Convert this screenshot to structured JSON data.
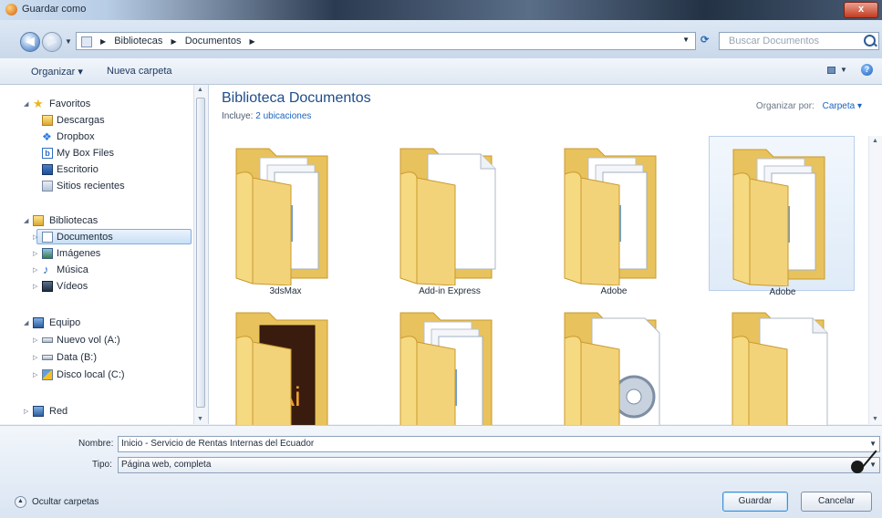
{
  "window": {
    "title": "Guardar como",
    "close_label": "x"
  },
  "address": {
    "crumbs": [
      "Bibliotecas",
      "Documentos"
    ],
    "search_placeholder": "Buscar Documentos"
  },
  "toolbar": {
    "organize": "Organizar ▾",
    "new_folder": "Nueva carpeta"
  },
  "nav": {
    "favorites": "Favoritos",
    "fav_items": [
      "Descargas",
      "Dropbox",
      "My Box Files",
      "Escritorio",
      "Sitios recientes"
    ],
    "libraries": "Bibliotecas",
    "lib_items": [
      "Documentos",
      "Imágenes",
      "Música",
      "Vídeos"
    ],
    "computer": "Equipo",
    "computer_items": [
      "Nuevo vol (A:)",
      "Data (B:)",
      "Disco local (C:)"
    ],
    "network": "Red"
  },
  "content": {
    "title": "Biblioteca Documentos",
    "includes_prefix": "Incluye:",
    "includes_link": "2 ubicaciones",
    "arrange_label": "Organizar por:",
    "arrange_value": "Carpeta ▾",
    "folders": [
      {
        "label": "3dsMax",
        "variant": "docs",
        "selected": false
      },
      {
        "label": "Add-in Express",
        "variant": "paper",
        "selected": false
      },
      {
        "label": "Adobe",
        "variant": "docs",
        "selected": false
      },
      {
        "label": "Adobe",
        "variant": "docs",
        "selected": true
      },
      {
        "label": "",
        "variant": "ai",
        "selected": false
      },
      {
        "label": "",
        "variant": "docs",
        "selected": false
      },
      {
        "label": "",
        "variant": "gear",
        "selected": false
      },
      {
        "label": "",
        "variant": "paper",
        "selected": false
      }
    ]
  },
  "form": {
    "name_label": "Nombre:",
    "name_value": "Inicio - Servicio de Rentas Internas del Ecuador",
    "type_label": "Tipo:",
    "type_value": "Página web, completa"
  },
  "footer": {
    "hide_folders": "Ocultar carpetas",
    "save": "Guardar",
    "cancel": "Cancelar"
  },
  "colors": {
    "accent": "#1e4d8c",
    "link": "#1a64c0",
    "folder": "#f3d37a"
  }
}
